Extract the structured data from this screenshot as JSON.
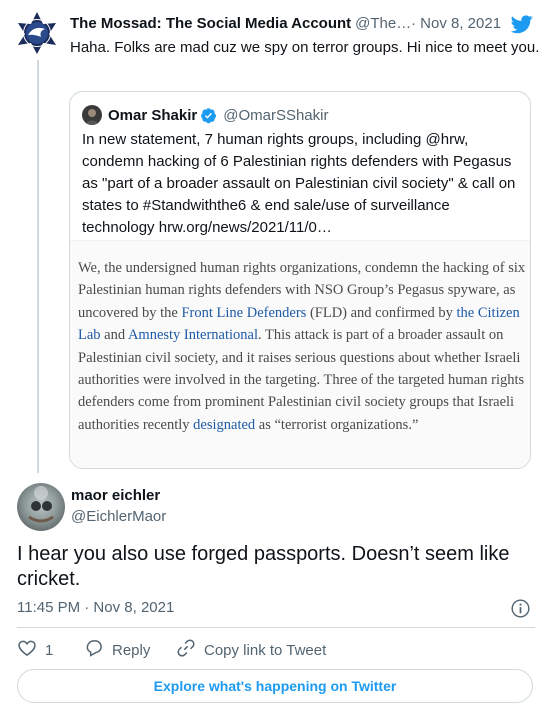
{
  "tweet": {
    "author_name": "The Mossad: The Social Media Account",
    "author_handle": "@The…",
    "date": "· Nov 8, 2021",
    "text": "Haha. Folks are mad cuz we spy on terror groups. Hi nice to meet you."
  },
  "quoted": {
    "author_name": "Omar Shakir",
    "author_handle": "@OmarSShakir",
    "text": "In new statement, 7 human rights groups, including @hrw, condemn hacking of 6 Palestinian rights defenders with Pegasus as \"part of a broader assault on Palestinian civil society\" & call on states to #Standwiththe6 & end sale/use of surveillance technology hrw.org/news/2021/11/0…",
    "image_text": {
      "p1": "We, the undersigned human rights organizations, condemn the hacking of six Palestinian human rights defenders with NSO Group’s Pegasus spyware, as uncovered by the ",
      "l1": "Front Line Defenders",
      "p2": " (FLD) and confirmed by ",
      "l2": "the Citizen Lab",
      "p3": " and ",
      "l3": "Amnesty International",
      "p4": ". This attack is part of a broader assault on Palestinian civil society, and it raises serious questions about whether Israeli authorities were involved in the targeting. Three of the targeted human rights defenders come from prominent Palestinian civil society groups that Israeli authorities recently ",
      "l4": "designated",
      "p5": " as “terrorist organizations.”"
    }
  },
  "reply": {
    "author_name": "maor eichler",
    "author_handle": "@EichlerMaor",
    "text": "I hear you also use forged passports. Doesn’t seem like cricket.",
    "time": "11:45 PM · Nov 8, 2021"
  },
  "actions": {
    "like_count": "1",
    "reply_label": "Reply",
    "copy_label": "Copy link to Tweet"
  },
  "footer": {
    "explore_label": "Explore what's happening on Twitter"
  },
  "colors": {
    "accent": "#1d9bf0",
    "secondary_text": "#536471",
    "border": "#cfd9de",
    "link_in_image": "#1f5aa6"
  },
  "icons": [
    "mossad-logo-icon",
    "twitter-bird-icon",
    "verified-badge-icon",
    "info-icon",
    "heart-icon",
    "reply-icon",
    "link-icon"
  ]
}
